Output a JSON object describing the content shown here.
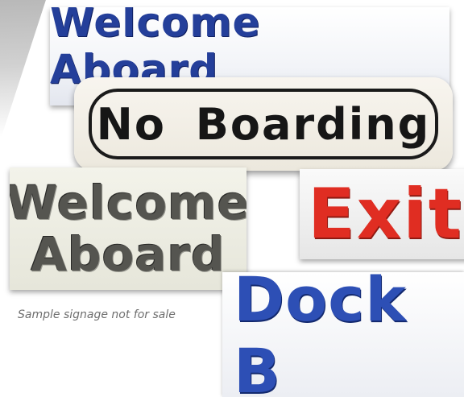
{
  "signs": {
    "welcome_top": "Welcome Aboard",
    "no_boarding": "No Boarding",
    "welcome_grey_line1": "Welcome",
    "welcome_grey_line2": "Aboard",
    "exit": "Exit",
    "dock_b": "Dock B"
  },
  "caption": "Sample signage not for sale",
  "colors": {
    "blue_lettering": "#243f9a",
    "black_lettering": "#161616",
    "grey_lettering": "#555550",
    "red_lettering": "#e02d22"
  }
}
